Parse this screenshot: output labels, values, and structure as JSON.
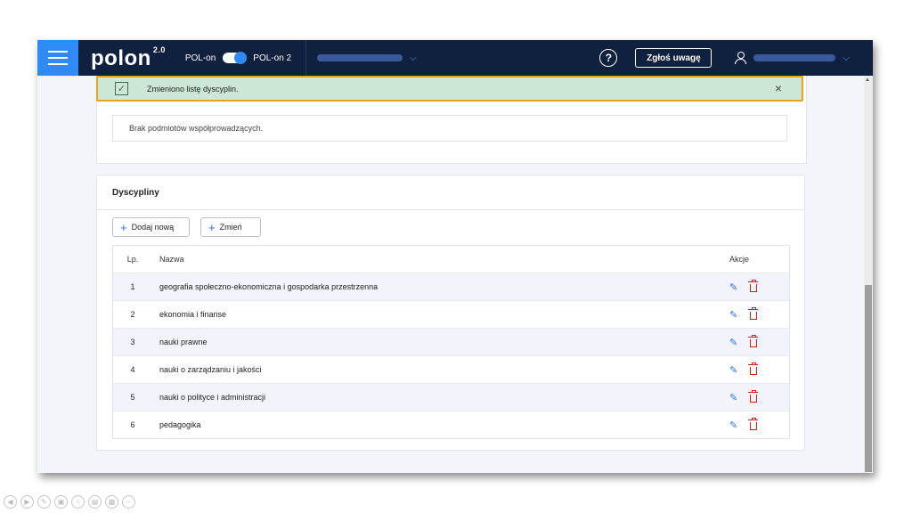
{
  "header": {
    "logo_text": "polon",
    "logo_version": "2.0",
    "pol_on_label": "POL-on",
    "pol_on2_label": "POL-on 2",
    "help_glyph": "?",
    "report_button": "Zgłoś uwagę"
  },
  "top_card": {
    "empty_message": "Brak podmiotów współprowadzących."
  },
  "toast": {
    "message": "Zmieniono listę dyscyplin.",
    "close_glyph": "×",
    "check_glyph": "✓"
  },
  "disciplines": {
    "title": "Dyscypliny",
    "add_button": "Dodaj nową",
    "change_button": "Zmień",
    "columns": {
      "lp": "Lp.",
      "name": "Nazwa",
      "actions": "Akcje"
    },
    "rows": [
      {
        "lp": "1",
        "name": "geografia społeczno-ekonomiczna i gospodarka przestrzenna"
      },
      {
        "lp": "2",
        "name": "ekonomia i finanse"
      },
      {
        "lp": "3",
        "name": "nauki prawne"
      },
      {
        "lp": "4",
        "name": "nauki o zarządzaniu i jakości"
      },
      {
        "lp": "5",
        "name": "nauki o polityce i administracji"
      },
      {
        "lp": "6",
        "name": "pedagogika"
      }
    ]
  },
  "icons": {
    "menu": "hamburger-icon",
    "help": "question-circle-icon",
    "user": "user-icon",
    "edit": "pencil-icon",
    "delete": "trash-icon",
    "close": "close-icon",
    "check": "check-icon",
    "add": "plus-icon"
  },
  "colors": {
    "header_bg": "#10203f",
    "accent_blue": "#2f8af5",
    "toast_bg": "#cde7d6",
    "toast_border": "#e5a41a",
    "delete_red": "#d01f1f"
  }
}
